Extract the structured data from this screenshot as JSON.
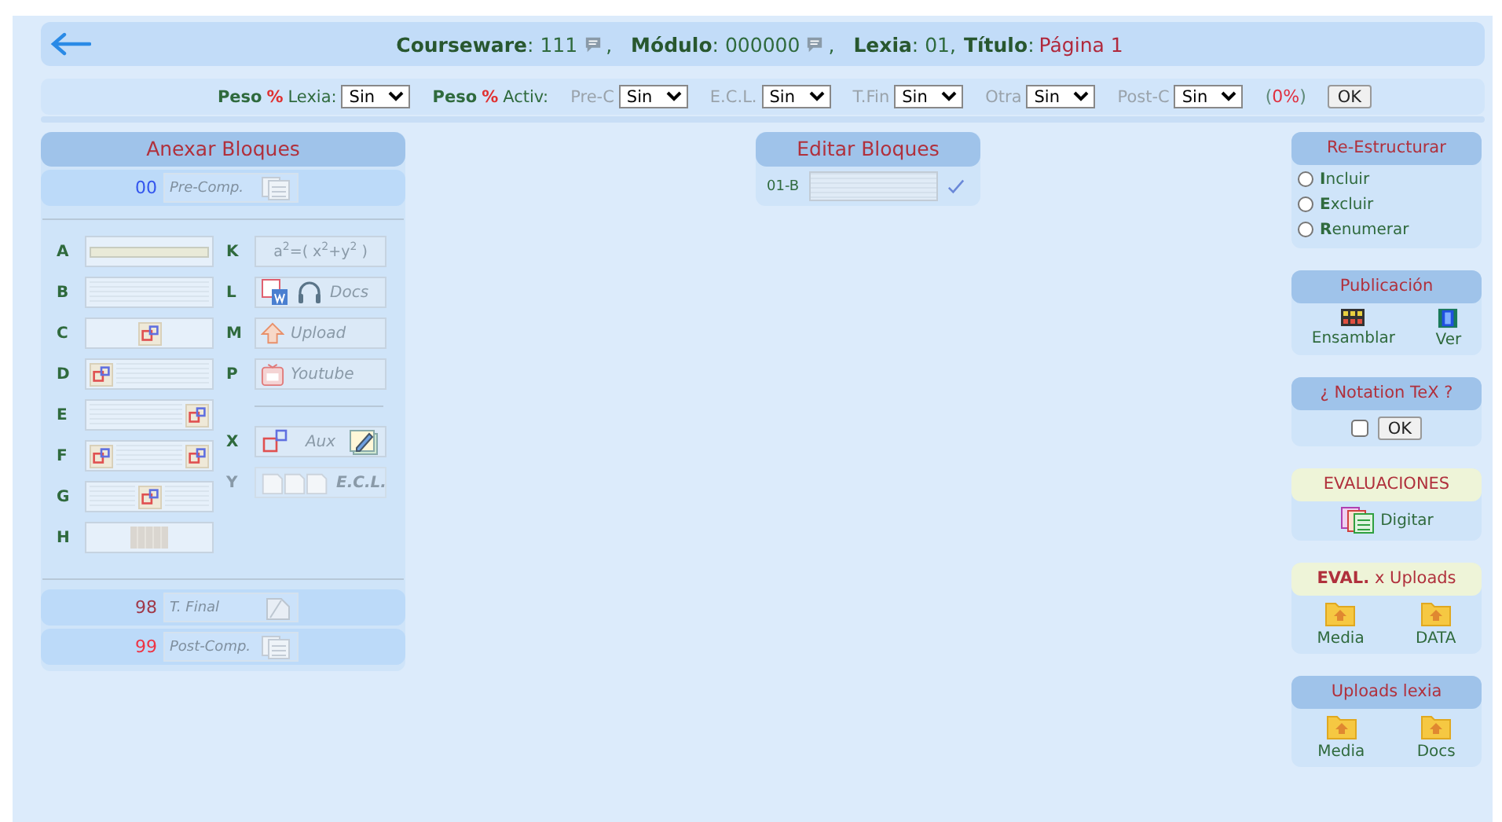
{
  "header": {
    "items": [
      {
        "text": "**Courseware**: 111",
        "note": true,
        "trail": ","
      },
      {
        "text": "**Módulo**: 000000",
        "note": true,
        "trail": ","
      },
      {
        "text": "**Lexia**: 01,",
        "note": false
      },
      {
        "text": "**Título**:",
        "note": false,
        "value": "Página 1"
      }
    ]
  },
  "weights": {
    "groups": [
      {
        "kind": "heading",
        "bold": "Peso",
        "pct": "%",
        "label": "Lexia:",
        "value": "Sin"
      },
      {
        "kind": "heading",
        "bold": "Peso",
        "pct": "%",
        "label": "Activ:"
      },
      {
        "kind": "select",
        "label": "Pre-C",
        "value": "Sin"
      },
      {
        "kind": "select",
        "label": "E.C.L.",
        "value": "Sin"
      },
      {
        "kind": "select",
        "label": "T.Fin",
        "value": "Sin"
      },
      {
        "kind": "select",
        "label": "Otra",
        "value": "Sin"
      },
      {
        "kind": "select",
        "label": "Post-C",
        "value": "Sin"
      }
    ],
    "total_open": "(",
    "total": "0%",
    "total_close": ")",
    "button": "OK"
  },
  "attach": {
    "title": "Anexar Bloques",
    "top": [
      {
        "kind": "documents",
        "number": "00",
        "label": "Pre-Comp.",
        "color": "#3355ee"
      }
    ],
    "left_blocks": [
      {
        "kind": "bar",
        "letter": "A"
      },
      {
        "kind": "lines",
        "letter": "B"
      },
      {
        "kind": "img-center",
        "letter": "C"
      },
      {
        "kind": "img-left",
        "letter": "D"
      },
      {
        "kind": "img-right",
        "letter": "E"
      },
      {
        "kind": "img-both",
        "letter": "F"
      },
      {
        "kind": "img-middle",
        "letter": "G"
      },
      {
        "kind": "grid",
        "letter": "H"
      }
    ],
    "right_blocks": [
      {
        "kind": "formula",
        "letter": "K",
        "text": "a$^{2}$=( x$^{2}$+y$^{2}$ )",
        "disabled": false
      },
      {
        "kind": "docs",
        "letter": "L",
        "text": "Docs",
        "disabled": false
      },
      {
        "kind": "upload",
        "letter": "M",
        "text": "Upload",
        "disabled": false
      },
      {
        "kind": "youtube",
        "letter": "P",
        "text": "Youtube",
        "disabled": false
      },
      {
        "kind": "divider"
      },
      {
        "kind": "aux",
        "letter": "X",
        "text": "Aux",
        "disabled": false
      },
      {
        "kind": "ecl",
        "letter": "Y",
        "text": "E.C.L.",
        "disabled": true
      }
    ],
    "bottom": [
      {
        "kind": "page",
        "number": "98",
        "label": "T. Final",
        "color": "#a03848"
      },
      {
        "kind": "documents",
        "number": "99",
        "label": "Post-Comp.",
        "color": "#ee3344"
      }
    ]
  },
  "edit": {
    "title": "Editar Bloques",
    "rows": [
      {
        "code": "01-B"
      }
    ]
  },
  "panels": [
    {
      "kind": "radios",
      "highlighted": false,
      "title": "Re-Estructurar",
      "options": [
        {
          "text": "**I**ncluir",
          "selected": false
        },
        {
          "text": "**E**xcluir",
          "selected": false
        },
        {
          "text": "**R**enumerar",
          "selected": false
        }
      ]
    },
    {
      "kind": "actions",
      "highlighted": false,
      "title": "Publicación",
      "actions": [
        {
          "kind": "assemble",
          "label": "Ensamblar"
        },
        {
          "kind": "view",
          "label": "Ver"
        }
      ]
    },
    {
      "kind": "tex",
      "highlighted": false,
      "title": "¿ Notation TeX ?",
      "checked": false,
      "button": "OK"
    },
    {
      "kind": "action-row",
      "highlighted": true,
      "title": "EVALUACIONES",
      "actions": [
        {
          "kind": "grade",
          "label": "Digitar"
        }
      ]
    },
    {
      "kind": "actions",
      "highlighted": true,
      "title": "**EVAL.** x Uploads",
      "actions": [
        {
          "kind": "upload",
          "label": "Media"
        },
        {
          "kind": "upload",
          "label": "DATA"
        }
      ]
    },
    {
      "kind": "actions",
      "highlighted": false,
      "title": "Uploads lexia",
      "actions": [
        {
          "kind": "upload",
          "label": "Media"
        },
        {
          "kind": "upload",
          "label": "Docs"
        }
      ]
    }
  ]
}
